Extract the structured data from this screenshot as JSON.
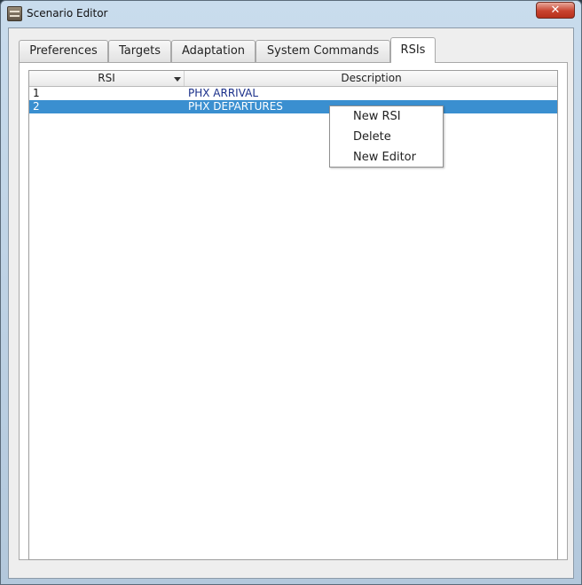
{
  "window": {
    "title": "Scenario Editor",
    "close_glyph": "✕"
  },
  "tabs": [
    {
      "label": "Preferences"
    },
    {
      "label": "Targets"
    },
    {
      "label": "Adaptation"
    },
    {
      "label": "System Commands"
    },
    {
      "label": "RSIs",
      "active": true
    }
  ],
  "table": {
    "columns": [
      "RSI",
      "Description"
    ],
    "sorted_column": "RSI",
    "rows": [
      {
        "rsi": "1",
        "description": "PHX ARRIVAL",
        "selected": false
      },
      {
        "rsi": "2",
        "description": "PHX DEPARTURES",
        "selected": true
      }
    ]
  },
  "context_menu": {
    "items": [
      "New RSI",
      "Delete",
      "New Editor"
    ]
  },
  "colors": {
    "selection": "#3a8fd0",
    "description_text": "#1a2f8a",
    "close_button": "#c8432f"
  }
}
